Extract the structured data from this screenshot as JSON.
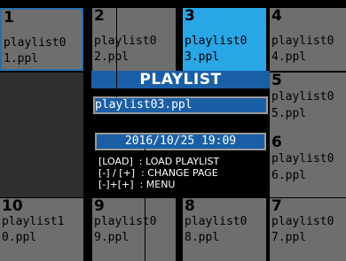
{
  "playlist_grid": {
    "cells": [
      {
        "number": "1",
        "name_line1": "playlist0",
        "name_line2": "1.ppl"
      },
      {
        "number": "2",
        "name_line1": "playlist0",
        "name_line2": "2.ppl"
      },
      {
        "number": "3",
        "name_line1": "playlist0",
        "name_line2": "3.ppl"
      },
      {
        "number": "4",
        "name_line1": "playlist0",
        "name_line2": "4.ppl"
      },
      {
        "number": "5",
        "name_line1": "playlist0",
        "name_line2": "5.ppl"
      },
      {
        "number": "6",
        "name_line1": "playlist0",
        "name_line2": "6.ppl"
      },
      {
        "number": "7",
        "name_line1": "playlist0",
        "name_line2": "7.ppl"
      },
      {
        "number": "8",
        "name_line1": "playlist0",
        "name_line2": "8.ppl"
      },
      {
        "number": "9",
        "name_line1": "playlist0",
        "name_line2": "9.ppl"
      },
      {
        "number": "10",
        "name_line1": "playlist1",
        "name_line2": "0.ppl"
      }
    ]
  },
  "info_panel": {
    "title": "PLAYLIST",
    "selected_file": "playlist03.ppl",
    "date_time": "2016/10/25 19:09",
    "help_line1": "[LOAD]  : LOAD PLAYLIST",
    "help_line2": "[-] / [+]  : CHANGE PAGE",
    "help_line3": "[-]+[+]  : MENU"
  },
  "colors": {
    "cell": "#6e6e6e",
    "empty_cell": "#2f2f2f",
    "selected_cell": "#29a6e6",
    "panel_title_bg": "#1a5fa6",
    "focus_border": "#2b6ea8"
  }
}
